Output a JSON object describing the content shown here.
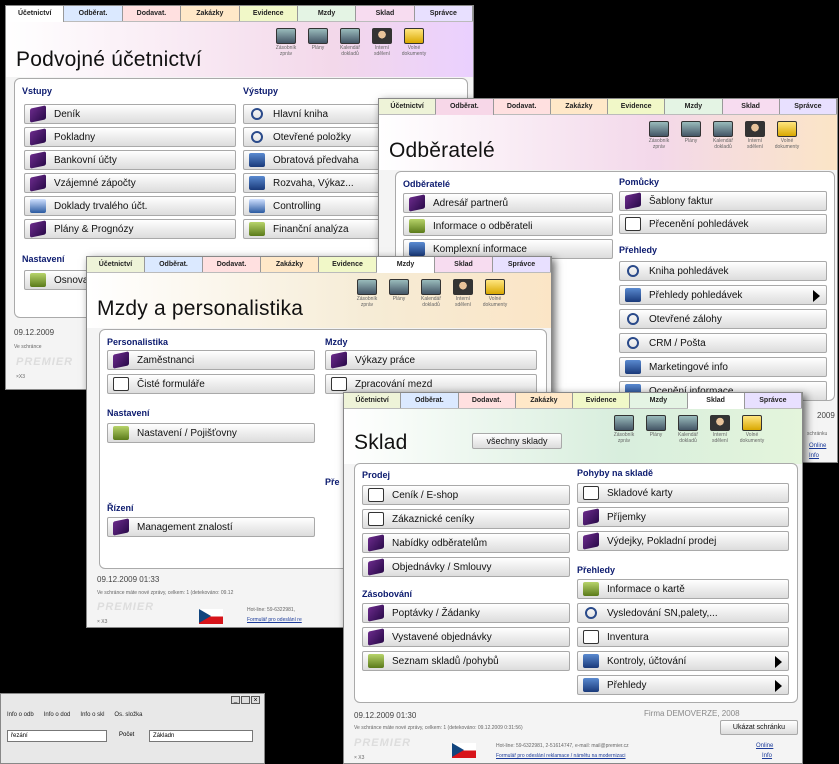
{
  "tabs1": [
    "Účetnictví",
    "Odběrat.",
    "Dodavat.",
    "Zakázky",
    "Evidence",
    "Mzdy",
    "Sklad",
    "Správce"
  ],
  "tabs2": [
    "Účetnictví",
    "Odběrat.",
    "Dodavat.",
    "Zakázky",
    "Evidence",
    "Mzdy",
    "Sklad",
    "Správce"
  ],
  "toolbar": {
    "zasobnik": "Zásobník zpráv",
    "plany": "Plány",
    "kalendar": "Kalendář dokladů",
    "zpravy": "Interní sdělení",
    "dokumenty": "Volné dokumenty"
  },
  "win_ucto": {
    "title": "Podvojné účetnictví",
    "sec_vstupy": "Vstupy",
    "sec_vystupy": "Výstupy",
    "sec_nastaveni": "Nastavení",
    "vstupy": [
      "Deník",
      "Pokladny",
      "Bankovní účty",
      "Vzájemné zápočty",
      "Doklady trvalého účt.",
      "Plány & Prognózy"
    ],
    "vystupy": [
      "Hlavní kniha",
      "Otevřené položky",
      "Obratová předvaha",
      "Rozvaha, Výkaz...",
      "Controlling",
      "Finanční analýza"
    ],
    "nastaveni": [
      "Osnova"
    ],
    "date": "09.12.2009",
    "notice": "Ve schránce",
    "flogo": "×X3"
  },
  "win_odb": {
    "title": "Odběratelé",
    "sec_odberatele": "Odběratelé",
    "sec_pomucky": "Pomůcky",
    "sec_prehledy": "Přehledy",
    "odberatele": [
      "Adresář partnerů",
      "Informace o odběrateli",
      "Komplexní informace"
    ],
    "pomucky": [
      "Šablony faktur",
      "Přecenění pohledávek"
    ],
    "prehledy": [
      "Kniha pohledávek",
      "Přehledy pohledávek",
      "Otevřené zálohy",
      "CRM / Pošta",
      "Marketingové info",
      "Ocenění informace"
    ],
    "date": "2009",
    "side1": "schránku",
    "side2": "Online",
    "side3": "Info"
  },
  "win_mzdy": {
    "title": "Mzdy a personalistika",
    "sec_personalistika": "Personalistika",
    "sec_mzdy": "Mzdy",
    "sec_nastaveni": "Nastavení",
    "sec_rizeni": "Řízení",
    "sec_pre": "Pře",
    "personalistika": [
      "Zaměstnanci",
      "Čisté formuláře"
    ],
    "mzdy": [
      "Výkazy práce",
      "Zpracování mezd"
    ],
    "nastaveni": [
      "Nastavení / Pojišťovny"
    ],
    "rizeni": [
      "Management znalostí"
    ],
    "date": "09.12.2009  01:33",
    "notice": "Ve schránce máte nové zprávy, celkem: 1 (detekováno: 09.12",
    "hotline": "Hot-line: 59-6322981,",
    "formular": "Formulář pro odeslání re",
    "flogo": "× X3"
  },
  "win_sklad": {
    "title": "Sklad",
    "all_btn": "všechny sklady",
    "sec_prodej": "Prodej",
    "sec_pohyby": "Pohyby na skladě",
    "sec_zasobovani": "Zásobování",
    "sec_prehledy": "Přehledy",
    "prodej": [
      "Ceník / E-shop",
      "Zákaznické ceníky",
      "Nabídky odběratelům",
      "Objednávky / Smlouvy"
    ],
    "pohyby": [
      "Skladové karty",
      "Příjemky",
      "Výdejky, Pokladní prodej"
    ],
    "zasobovani": [
      "Poptávky / Žádanky",
      "Vystavené objednávky",
      "Seznam skladů /pohybů"
    ],
    "prehledy": [
      "Informace o kartě",
      "Vysledování SN,palety,...",
      "Inventura",
      "Kontroly, účtování",
      "Přehledy"
    ],
    "date": "09.12.2009  01:30",
    "firma": "Firma DEMOVERZE, 2008",
    "notice": "Ve schránce máte nové zprávy, celkem: 1 (detekováno: 09.12.2009  0:31:56)",
    "show_btn": "Ukázat schránku",
    "hotline": "Hot-line: 59-6322981, 2-51614747, e-mail: mail@premier.cz",
    "formular": "Formulář pro odeslání reklamace / námětu na modernizaci",
    "online": "Online",
    "info": "Info",
    "flogo": "× X3"
  },
  "win_small": {
    "buttons": [
      "Info o odb",
      "Info o dod",
      "Info o skl",
      "Os. složka"
    ],
    "field_label": "Počet",
    "field_value": "Základn",
    "field_left": "řezání"
  }
}
